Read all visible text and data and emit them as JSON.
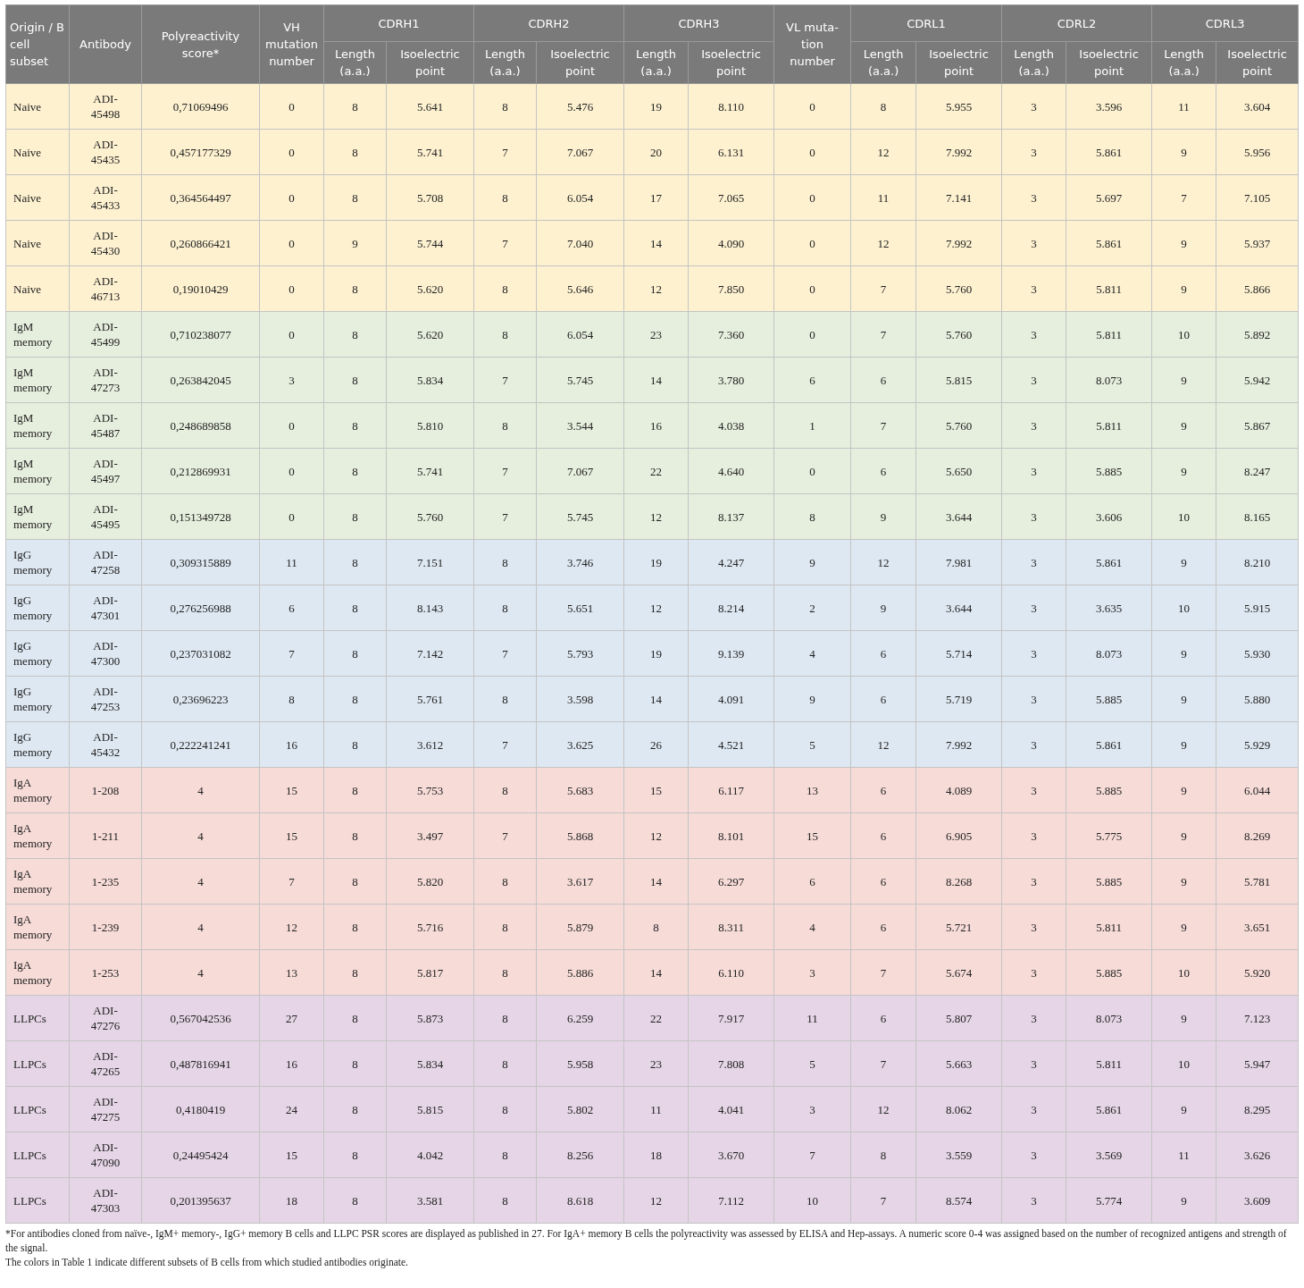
{
  "table": {
    "columns": [
      {
        "kind": "single",
        "label": "Origin / B cell subset"
      },
      {
        "kind": "single",
        "label": "Antibody"
      },
      {
        "kind": "single",
        "label": "Polyreactivity score*"
      },
      {
        "kind": "single",
        "label": "VH mutation number"
      },
      {
        "kind": "grouped",
        "label": "Length (a.a.)"
      },
      {
        "kind": "grouped",
        "label": "Isoelectric point"
      },
      {
        "kind": "grouped",
        "label": "Length (a.a.)"
      },
      {
        "kind": "grouped",
        "label": "Isoelectric point"
      },
      {
        "kind": "grouped",
        "label": "Length (a.a.)"
      },
      {
        "kind": "grouped",
        "label": "Isoelectric point"
      },
      {
        "kind": "single",
        "label": "VL muta-tion number"
      },
      {
        "kind": "grouped",
        "label": "Length (a.a.)"
      },
      {
        "kind": "grouped",
        "label": "Isoelectric point"
      },
      {
        "kind": "grouped",
        "label": "Length (a.a.)"
      },
      {
        "kind": "grouped",
        "label": "Isoelectric point"
      },
      {
        "kind": "grouped",
        "label": "Length (a.a.)"
      },
      {
        "kind": "grouped",
        "label": "Isoelectric point"
      }
    ],
    "column_groups": [
      {
        "label": "CDRH1"
      },
      {
        "label": "CDRH2"
      },
      {
        "label": "CDRH3"
      },
      {
        "label": "CDRL1"
      },
      {
        "label": "CDRL2"
      },
      {
        "label": "CDRL3"
      }
    ],
    "rows": [
      {
        "color": "#fdf1d0",
        "cells": [
          "Naive",
          "ADI-45498",
          "0,71069496",
          "0",
          "8",
          "5.641",
          "8",
          "5.476",
          "19",
          "8.110",
          "0",
          "8",
          "5.955",
          "3",
          "3.596",
          "11",
          "3.604"
        ]
      },
      {
        "color": "#fdf1d0",
        "cells": [
          "Naive",
          "ADI-45435",
          "0,457177329",
          "0",
          "8",
          "5.741",
          "7",
          "7.067",
          "20",
          "6.131",
          "0",
          "12",
          "7.992",
          "3",
          "5.861",
          "9",
          "5.956"
        ]
      },
      {
        "color": "#fdf1d0",
        "cells": [
          "Naive",
          "ADI-45433",
          "0,364564497",
          "0",
          "8",
          "5.708",
          "8",
          "6.054",
          "17",
          "7.065",
          "0",
          "11",
          "7.141",
          "3",
          "5.697",
          "7",
          "7.105"
        ]
      },
      {
        "color": "#fdf1d0",
        "cells": [
          "Naive",
          "ADI-45430",
          "0,260866421",
          "0",
          "9",
          "5.744",
          "7",
          "7.040",
          "14",
          "4.090",
          "0",
          "12",
          "7.992",
          "3",
          "5.861",
          "9",
          "5.937"
        ]
      },
      {
        "color": "#fdf1d0",
        "cells": [
          "Naive",
          "ADI-46713",
          "0,19010429",
          "0",
          "8",
          "5.620",
          "8",
          "5.646",
          "12",
          "7.850",
          "0",
          "7",
          "5.760",
          "3",
          "5.811",
          "9",
          "5.866"
        ]
      },
      {
        "color": "#e6eedd",
        "cells": [
          "IgM memory",
          "ADI-45499",
          "0,710238077",
          "0",
          "8",
          "5.620",
          "8",
          "6.054",
          "23",
          "7.360",
          "0",
          "7",
          "5.760",
          "3",
          "5.811",
          "10",
          "5.892"
        ]
      },
      {
        "color": "#e6eedd",
        "cells": [
          "IgM memory",
          "ADI-47273",
          "0,263842045",
          "3",
          "8",
          "5.834",
          "7",
          "5.745",
          "14",
          "3.780",
          "6",
          "6",
          "5.815",
          "3",
          "8.073",
          "9",
          "5.942"
        ]
      },
      {
        "color": "#e6eedd",
        "cells": [
          "IgM memory",
          "ADI-45487",
          "0,248689858",
          "0",
          "8",
          "5.810",
          "8",
          "3.544",
          "16",
          "4.038",
          "1",
          "7",
          "5.760",
          "3",
          "5.811",
          "9",
          "5.867"
        ]
      },
      {
        "color": "#e6eedd",
        "cells": [
          "IgM memory",
          "ADI-45497",
          "0,212869931",
          "0",
          "8",
          "5.741",
          "7",
          "7.067",
          "22",
          "4.640",
          "0",
          "6",
          "5.650",
          "3",
          "5.885",
          "9",
          "8.247"
        ]
      },
      {
        "color": "#e6eedd",
        "cells": [
          "IgM memory",
          "ADI-45495",
          "0,151349728",
          "0",
          "8",
          "5.760",
          "7",
          "5.745",
          "12",
          "8.137",
          "8",
          "9",
          "3.644",
          "3",
          "3.606",
          "10",
          "8.165"
        ]
      },
      {
        "color": "#dee8f2",
        "cells": [
          "IgG memory",
          "ADI-47258",
          "0,309315889",
          "11",
          "8",
          "7.151",
          "8",
          "3.746",
          "19",
          "4.247",
          "9",
          "12",
          "7.981",
          "3",
          "5.861",
          "9",
          "8.210"
        ]
      },
      {
        "color": "#dee8f2",
        "cells": [
          "IgG memory",
          "ADI-47301",
          "0,276256988",
          "6",
          "8",
          "8.143",
          "8",
          "5.651",
          "12",
          "8.214",
          "2",
          "9",
          "3.644",
          "3",
          "3.635",
          "10",
          "5.915"
        ]
      },
      {
        "color": "#dee8f2",
        "cells": [
          "IgG memory",
          "ADI-47300",
          "0,237031082",
          "7",
          "8",
          "7.142",
          "7",
          "5.793",
          "19",
          "9.139",
          "4",
          "6",
          "5.714",
          "3",
          "8.073",
          "9",
          "5.930"
        ]
      },
      {
        "color": "#dee8f2",
        "cells": [
          "IgG memory",
          "ADI-47253",
          "0,23696223",
          "8",
          "8",
          "5.761",
          "8",
          "3.598",
          "14",
          "4.091",
          "9",
          "6",
          "5.719",
          "3",
          "5.885",
          "9",
          "5.880"
        ]
      },
      {
        "color": "#dee8f2",
        "cells": [
          "IgG memory",
          "ADI-45432",
          "0,222241241",
          "16",
          "8",
          "3.612",
          "7",
          "3.625",
          "26",
          "4.521",
          "5",
          "12",
          "7.992",
          "3",
          "5.861",
          "9",
          "5.929"
        ]
      },
      {
        "color": "#f6dbd7",
        "cells": [
          "IgA memory",
          "1-208",
          "4",
          "15",
          "8",
          "5.753",
          "8",
          "5.683",
          "15",
          "6.117",
          "13",
          "6",
          "4.089",
          "3",
          "5.885",
          "9",
          "6.044"
        ]
      },
      {
        "color": "#f6dbd7",
        "cells": [
          "IgA memory",
          "1-211",
          "4",
          "15",
          "8",
          "3.497",
          "7",
          "5.868",
          "12",
          "8.101",
          "15",
          "6",
          "6.905",
          "3",
          "5.775",
          "9",
          "8.269"
        ]
      },
      {
        "color": "#f6dbd7",
        "cells": [
          "IgA memory",
          "1-235",
          "4",
          "7",
          "8",
          "5.820",
          "8",
          "3.617",
          "14",
          "6.297",
          "6",
          "6",
          "8.268",
          "3",
          "5.885",
          "9",
          "5.781"
        ]
      },
      {
        "color": "#f6dbd7",
        "cells": [
          "IgA memory",
          "1-239",
          "4",
          "12",
          "8",
          "5.716",
          "8",
          "5.879",
          "8",
          "8.311",
          "4",
          "6",
          "5.721",
          "3",
          "5.811",
          "9",
          "3.651"
        ]
      },
      {
        "color": "#f6dbd7",
        "cells": [
          "IgA memory",
          "1-253",
          "4",
          "13",
          "8",
          "5.817",
          "8",
          "5.886",
          "14",
          "6.110",
          "3",
          "7",
          "5.674",
          "3",
          "5.885",
          "10",
          "5.920"
        ]
      },
      {
        "color": "#e5d5e6",
        "cells": [
          "LLPCs",
          "ADI-47276",
          "0,567042536",
          "27",
          "8",
          "5.873",
          "8",
          "6.259",
          "22",
          "7.917",
          "11",
          "6",
          "5.807",
          "3",
          "8.073",
          "9",
          "7.123"
        ]
      },
      {
        "color": "#e5d5e6",
        "cells": [
          "LLPCs",
          "ADI-47265",
          "0,487816941",
          "16",
          "8",
          "5.834",
          "8",
          "5.958",
          "23",
          "7.808",
          "5",
          "7",
          "5.663",
          "3",
          "5.811",
          "10",
          "5.947"
        ]
      },
      {
        "color": "#e5d5e6",
        "cells": [
          "LLPCs",
          "ADI-47275",
          "0,4180419",
          "24",
          "8",
          "5.815",
          "8",
          "5.802",
          "11",
          "4.041",
          "3",
          "12",
          "8.062",
          "3",
          "5.861",
          "9",
          "8.295"
        ]
      },
      {
        "color": "#e5d5e6",
        "cells": [
          "LLPCs",
          "ADI-47090",
          "0,24495424",
          "15",
          "8",
          "4.042",
          "8",
          "8.256",
          "18",
          "3.670",
          "7",
          "8",
          "3.559",
          "3",
          "3.569",
          "11",
          "3.626"
        ]
      },
      {
        "color": "#e5d5e6",
        "cells": [
          "LLPCs",
          "ADI-47303",
          "0,201395637",
          "18",
          "8",
          "3.581",
          "8",
          "8.618",
          "12",
          "7.112",
          "10",
          "7",
          "8.574",
          "3",
          "5.774",
          "9",
          "3.609"
        ]
      }
    ]
  },
  "footnotes": [
    "*For antibodies cloned from naïve-, IgM+ memory-, IgG+ memory B cells and LLPC PSR scores are displayed as published in 27. For IgA+ memory B cells the polyreactivity was assessed by ELISA and Hep-assays. A numeric score 0-4 was assigned based on the number of recognized antigens and strength of the signal.",
    "The colors in Table 1 indicate different subsets of B cells from which studied antibodies originate."
  ]
}
